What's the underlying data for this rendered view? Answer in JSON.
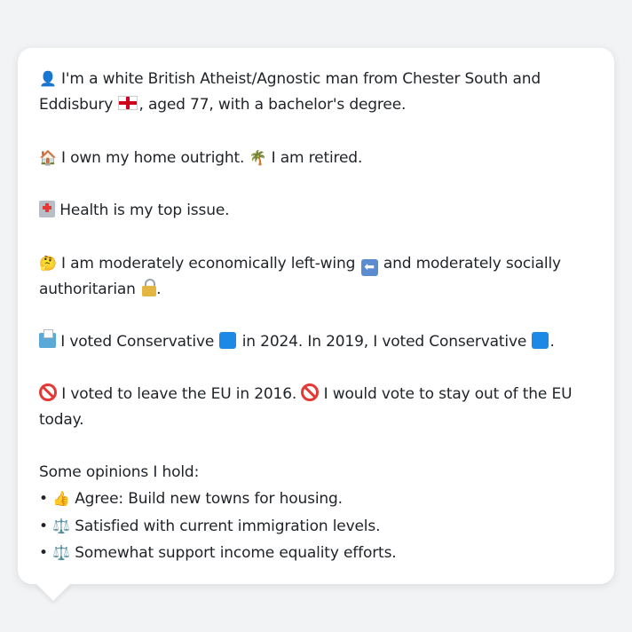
{
  "bio": {
    "identity": {
      "icon": "bust-in-silhouette-icon",
      "line1": "I'm a white British Atheist/Agnostic man from Chester South and",
      "line2_a": "Eddisbury",
      "flag_icon": "england-flag-icon",
      "line2_b": ", aged 77, with a bachelor's degree."
    },
    "home": {
      "house_icon": "house-icon",
      "text_a": "I own my home outright.",
      "palm_icon": "palm-tree-icon",
      "text_b": "I am retired."
    },
    "health": {
      "icon": "hospital-icon",
      "text": "Health is my top issue."
    },
    "ideology": {
      "thinking_icon": "thinking-face-icon",
      "text_a": "I am moderately economically left-wing",
      "left_arrow_icon": "left-arrow-icon",
      "text_b": "and moderately socially",
      "line2": "authoritarian",
      "lock_icon": "lock-icon",
      "line2_end": "."
    },
    "votes": {
      "ballot_icon": "ballot-box-icon",
      "text_a": "I voted Conservative",
      "square_icon": "blue-square-icon",
      "text_b": "in 2024. In 2019, I voted Conservative",
      "text_end": "."
    },
    "brexit": {
      "icon": "no-entry-icon",
      "text_a": "I voted to leave the EU in 2016.",
      "text_b": "I would vote to stay out of the EU",
      "line2": "today."
    },
    "opinions": {
      "heading": "Some opinions I hold:",
      "items": [
        {
          "bullet": "•",
          "icon": "👍",
          "icon_name": "thumbs-up-icon",
          "text": "Agree: Build new towns for housing."
        },
        {
          "bullet": "•",
          "icon": "⚖️",
          "icon_name": "balance-scale-icon",
          "text": "Satisfied with current immigration levels."
        },
        {
          "bullet": "•",
          "icon": "⚖️",
          "icon_name": "balance-scale-icon",
          "text": "Somewhat support income equality efforts."
        }
      ]
    }
  },
  "colors": {
    "background": "#f1f3f5",
    "card": "#ffffff",
    "text": "#1f2328",
    "conservative_blue": "#1e88e5"
  }
}
